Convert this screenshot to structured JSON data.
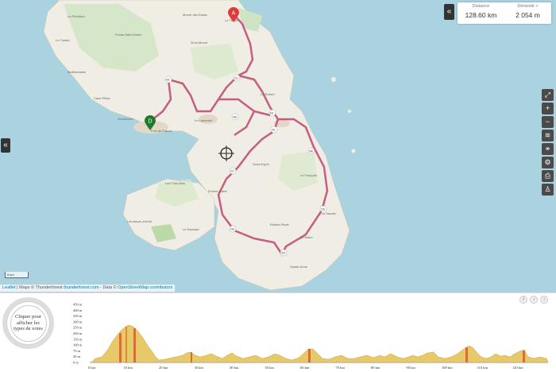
{
  "stats": {
    "distance_label": "Distance",
    "distance_value": "128.60 km",
    "elevation_label": "Dénivelé +",
    "elevation_value": "2 054 m"
  },
  "markers": {
    "start": "A",
    "end": "D"
  },
  "scale_label": "5 km",
  "attribution": {
    "leaflet": "Leaflet",
    "text1": " | Maps © Thunderforest ",
    "thunderforest_link": "thunderforest.com",
    "text2": " - Data © ",
    "osm_link": "OpenStreetMap contributors"
  },
  "road_types_label": "Cliquer pour afficher les types de voies",
  "map_labels": [
    "Le Prêcheur",
    "Morne des Esses",
    "Le Carbet",
    "Fonds-Saint-Denis",
    "Gros-Morne",
    "Bellefontaine",
    "Case-Pilote",
    "Schoelcher",
    "Fort-de-France",
    "Le Lamentin",
    "Le Robert",
    "Le François",
    "Les Trois-Îlets",
    "Rivière-Salée",
    "Saint-Esprit",
    "Le Vauclin",
    "Les Anses-d'Arlet",
    "Le Diamant",
    "Rivière-Pilote",
    "Le Marin",
    "Sainte-Anne",
    "La Trinité"
  ],
  "road_numbers": [
    "N2",
    "D1",
    "N1",
    "N5",
    "N6",
    "D7",
    "A1",
    "D6",
    "N9",
    "D5"
  ],
  "elevation_chart": {
    "ylabels": [
      "450 m",
      "400 m",
      "350 m",
      "300 m",
      "250 m",
      "200 m",
      "150 m",
      "100 m",
      "70 m",
      "30 m",
      "0 m"
    ],
    "xlabels": [
      "0 km",
      "10 km",
      "20 km",
      "30 km",
      "40 km",
      "50 km",
      "60 km",
      "70 km",
      "80 km",
      "90 km",
      "100 km",
      "110 km",
      "120 km"
    ]
  }
}
